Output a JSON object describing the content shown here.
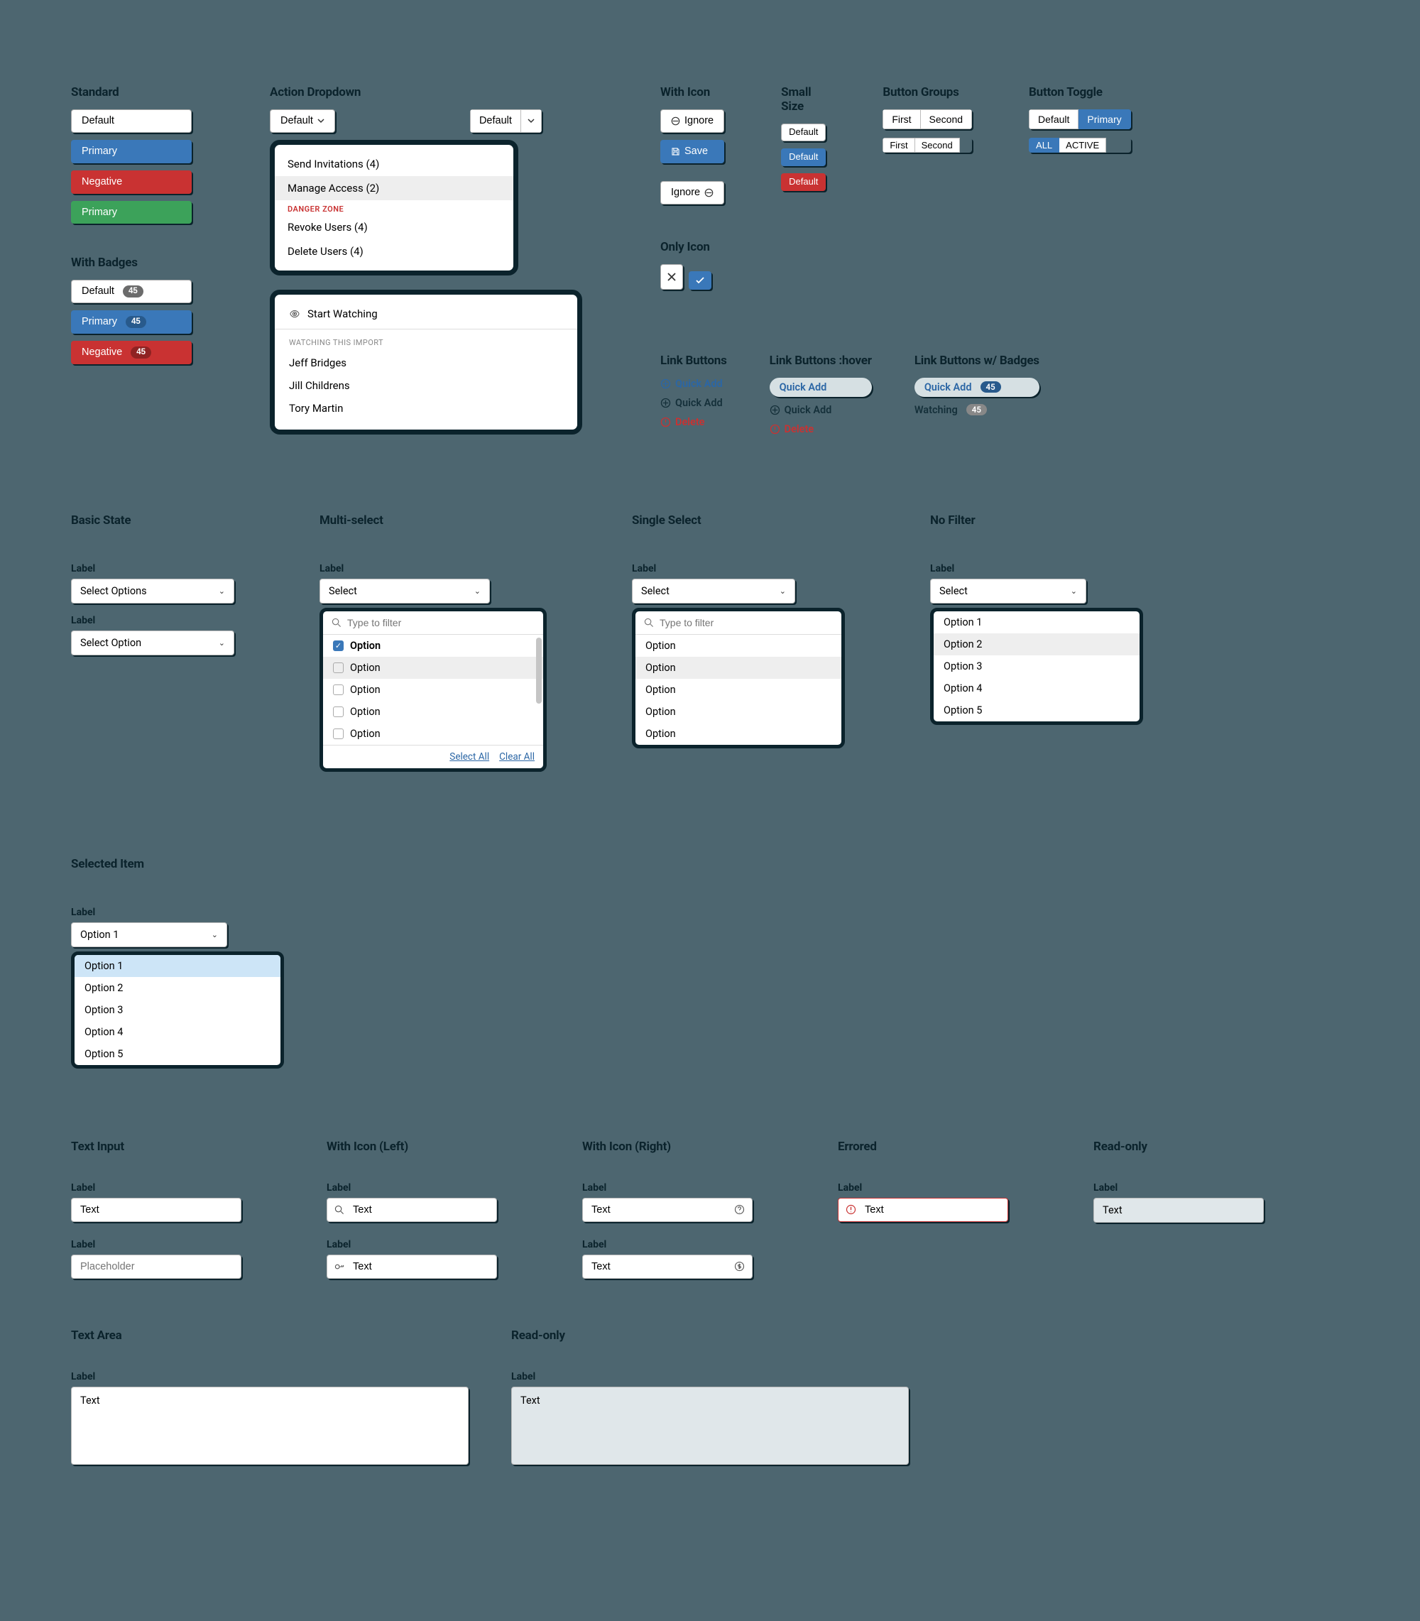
{
  "row1": {
    "standard": {
      "title": "Standard",
      "default": "Default",
      "primary": "Primary",
      "negative": "Negative",
      "green": "Primary"
    },
    "with_badges": {
      "title": "With Badges",
      "default": "Default",
      "primary": "Primary",
      "negative": "Negative",
      "badge": "45"
    },
    "action_dropdown": {
      "title": "Action Dropdown",
      "default": "Default",
      "split_default": "Default",
      "items": [
        "Send Invitations (4)",
        "Manage Access (2)"
      ],
      "danger_label": "DANGER ZONE",
      "danger_items": [
        "Revoke Users (4)",
        "Delete Users (4)"
      ]
    },
    "watching": {
      "start": "Start Watching",
      "sec": "WATCHING THIS IMPORT",
      "people": [
        "Jeff Bridges",
        "Jill Childrens",
        "Tory Martin"
      ]
    },
    "with_icon": {
      "title": "With Icon",
      "ignore": "Ignore",
      "save": "Save",
      "ignore2": "Ignore"
    },
    "only_icon": {
      "title": "Only Icon"
    },
    "small": {
      "title": "Small Size",
      "default": "Default",
      "default2": "Default",
      "default3": "Default"
    },
    "groups": {
      "title": "Button Groups",
      "first": "First",
      "second": "Second"
    },
    "toggle": {
      "title": "Button Toggle",
      "default": "Default",
      "primary": "Primary",
      "all": "ALL",
      "active": "ACTIVE"
    },
    "link": {
      "title": "Link Buttons",
      "hover_title": "Link Buttons :hover",
      "badge_title": "Link Buttons w/ Badges",
      "quick_add": "Quick Add",
      "delete": "Delete",
      "watching": "Watching",
      "badge": "45"
    }
  },
  "row2": {
    "basic": {
      "title": "Basic State",
      "label": "Label",
      "ph1": "Select Options",
      "ph2": "Select Option"
    },
    "multi": {
      "title": "Multi-select",
      "label": "Label",
      "select": "Select",
      "filter_ph": "Type to filter",
      "option": "Option",
      "select_all": "Select All",
      "clear_all": "Clear All"
    },
    "single": {
      "title": "Single Select",
      "label": "Label",
      "select": "Select",
      "filter_ph": "Type to filter",
      "option": "Option"
    },
    "nofilter": {
      "title": "No Filter",
      "label": "Label",
      "select": "Select",
      "options": [
        "Option 1",
        "Option 2",
        "Option 3",
        "Option 4",
        "Option 5"
      ]
    },
    "selected": {
      "title": "Selected Item",
      "label": "Label",
      "value": "Option 1",
      "options": [
        "Option 1",
        "Option 2",
        "Option 3",
        "Option 4",
        "Option 5"
      ]
    }
  },
  "row3": {
    "text_input": {
      "title": "Text Input",
      "label": "Label",
      "text": "Text",
      "ph": "Placeholder"
    },
    "icon_left": {
      "title": "With Icon (Left)",
      "label": "Label",
      "text": "Text"
    },
    "icon_right": {
      "title": "With Icon (Right)",
      "label": "Label",
      "text": "Text"
    },
    "errored": {
      "title": "Errored",
      "label": "Label",
      "text": "Text"
    },
    "readonly": {
      "title": "Read-only",
      "label": "Label",
      "text": "Text"
    }
  },
  "row4": {
    "textarea": {
      "title": "Text Area",
      "label": "Label",
      "text": "Text"
    },
    "readonly": {
      "title": "Read-only",
      "label": "Label",
      "text": "Text"
    }
  }
}
